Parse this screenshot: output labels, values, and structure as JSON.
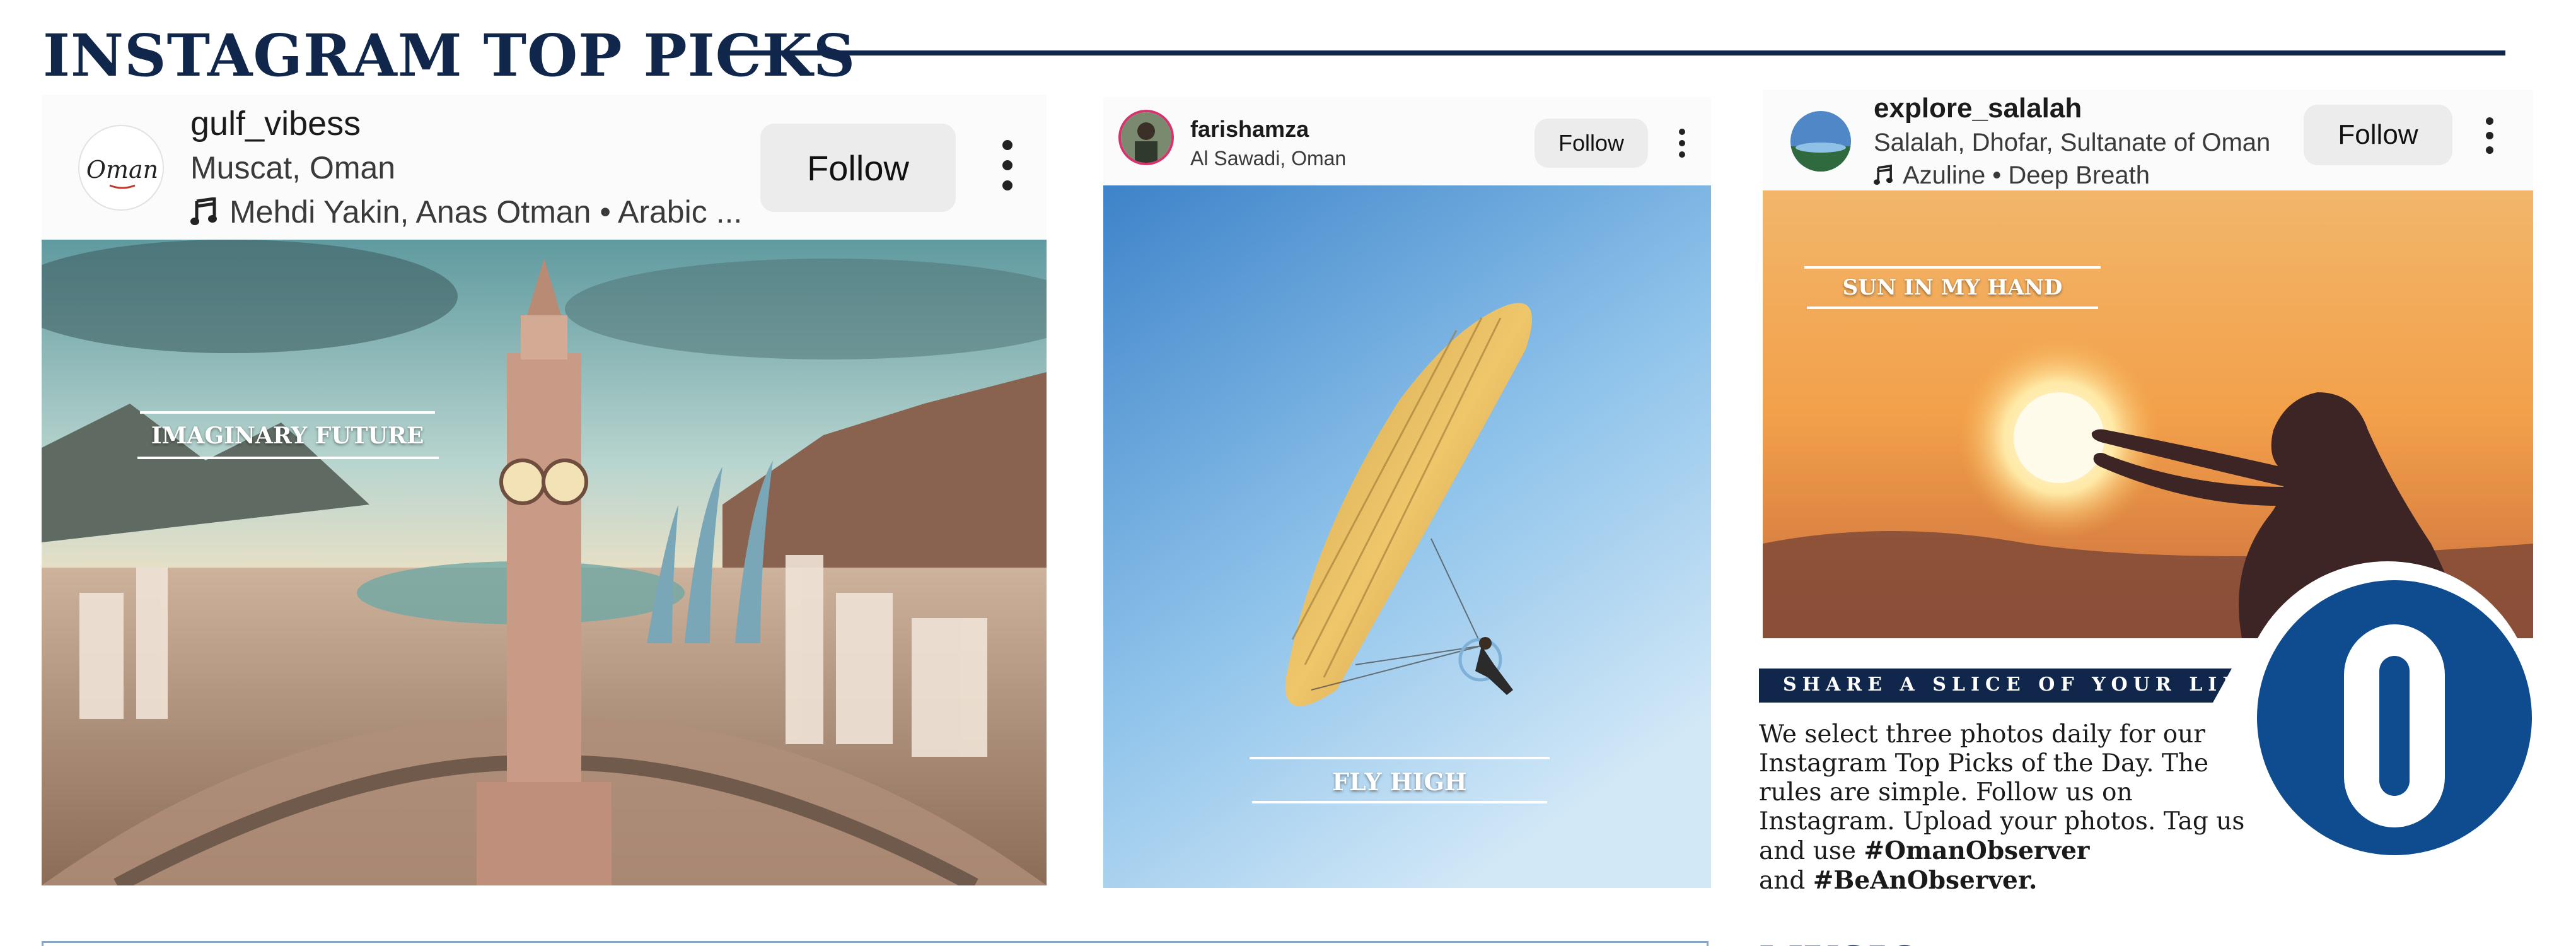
{
  "page": {
    "title": "INSTAGRAM TOP PICKS"
  },
  "posts": [
    {
      "username": "gulf_vibess",
      "location": "Muscat, Oman",
      "music": "Mehdi Yakin, Anas Otman • Arabic ...",
      "follow_label": "Follow",
      "avatar_text": "Oman",
      "caption": "IMAGINARY FUTURE"
    },
    {
      "username": "farishamza",
      "location": "Al Sawadi, Oman",
      "follow_label": "Follow",
      "caption": "FLY HIGH"
    },
    {
      "username": "explore_salalah",
      "location": "Salalah, Dhofar, Sultanate of Oman",
      "music": "Azuline • Deep Breath",
      "follow_label": "Follow",
      "caption": "SUN IN MY HAND"
    }
  ],
  "share": {
    "heading": "SHARE A SLICE OF YOUR LIFE",
    "body_plain": "We select three photos daily for our Instagram Top Picks of the Day. The rules are simple. Follow us on Instagram. Upload your photos. Tag us and use",
    "hashtag1": "#OmanObserver",
    "and_word": "and",
    "hashtag2": "#BeAnObserver."
  },
  "bottom": {
    "heading": "MUSIC"
  },
  "colors": {
    "navy": "#10264a",
    "brand_blue": "#0f4b8f",
    "follow_bg": "#ececec"
  },
  "icons": {
    "more": "more-vertical-icon",
    "music": "music-note-icon",
    "logo": "observer-o-logo"
  }
}
